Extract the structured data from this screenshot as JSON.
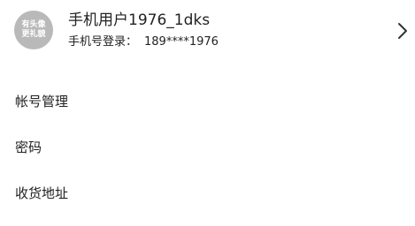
{
  "profile": {
    "avatar_line1": "有头像",
    "avatar_line2": "更礼貌",
    "name": "手机用户1976_1dks",
    "login_label": "手机号登录：",
    "phone": "189****1976",
    "chevron_icon": "chevron-right-icon"
  },
  "menu": {
    "items": [
      {
        "label": "帐号管理"
      },
      {
        "label": "密码"
      },
      {
        "label": "收货地址"
      }
    ]
  },
  "colors": {
    "background": "#ffffff",
    "text": "#222222",
    "avatar_bg": "#b9b9b9"
  }
}
